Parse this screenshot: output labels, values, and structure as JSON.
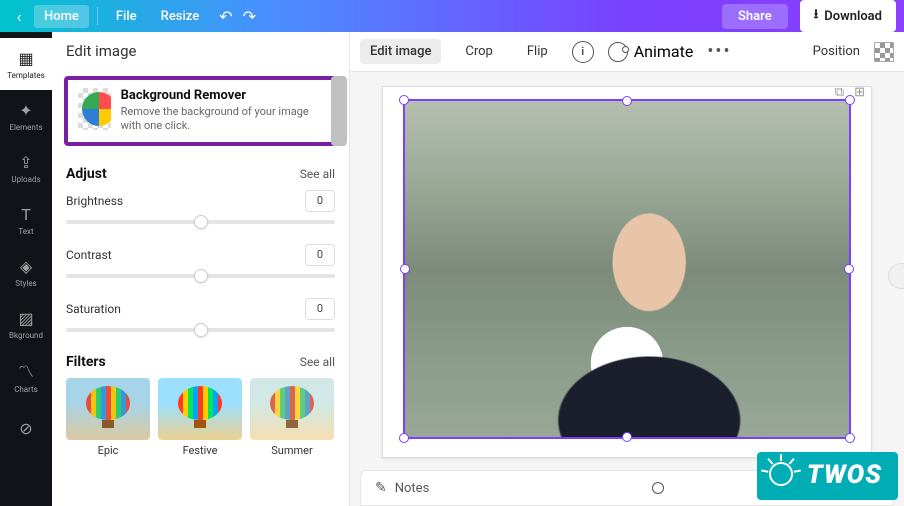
{
  "topbar": {
    "home": "Home",
    "file": "File",
    "resize": "Resize",
    "share": "Share",
    "download": "Download"
  },
  "sidebar": {
    "items": [
      {
        "label": "Templates",
        "icon": "▦"
      },
      {
        "label": "Elements",
        "icon": "✦"
      },
      {
        "label": "Uploads",
        "icon": "⇪"
      },
      {
        "label": "Text",
        "icon": "T"
      },
      {
        "label": "Styles",
        "icon": "◈"
      },
      {
        "label": "Bkground",
        "icon": "▨"
      },
      {
        "label": "Charts",
        "icon": "📈"
      },
      {
        "label": "",
        "icon": "⊘"
      }
    ]
  },
  "panel": {
    "title": "Edit image",
    "bgRemover": {
      "title": "Background Remover",
      "desc": "Remove the background of your image with one click."
    },
    "adjust": {
      "title": "Adjust",
      "seeall": "See all",
      "brightness": {
        "label": "Brightness",
        "value": "0"
      },
      "contrast": {
        "label": "Contrast",
        "value": "0"
      },
      "saturation": {
        "label": "Saturation",
        "value": "0"
      }
    },
    "filters": {
      "title": "Filters",
      "seeall": "See all",
      "items": [
        {
          "label": "Epic"
        },
        {
          "label": "Festive"
        },
        {
          "label": "Summer"
        }
      ]
    }
  },
  "contextbar": {
    "edit": "Edit image",
    "crop": "Crop",
    "flip": "Flip",
    "animate": "Animate",
    "position": "Position"
  },
  "notes": {
    "label": "Notes"
  },
  "badge": {
    "text": "TWOS"
  }
}
